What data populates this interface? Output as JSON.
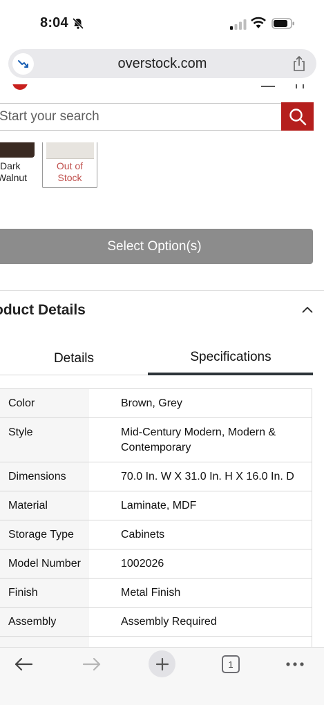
{
  "status_bar": {
    "time": "8:04"
  },
  "browser": {
    "url": "overstock.com"
  },
  "search": {
    "placeholder": "Start your search"
  },
  "color_options": [
    {
      "label": "Dark\nWalnut",
      "display": "Dark Walnut",
      "state": "available"
    },
    {
      "label": "Out of\nStock",
      "display": "Out of Stock",
      "state": "out_of_stock"
    }
  ],
  "swatch_labels": {
    "dark_line1": "Dark",
    "dark_line2": "Walnut",
    "oos_line1": "Out of",
    "oos_line2": "Stock"
  },
  "select_button": {
    "label": "Select Option(s)"
  },
  "product_details": {
    "title": "oduct Details",
    "tabs": [
      {
        "label": "Details",
        "active": false
      },
      {
        "label": "Specifications",
        "active": true
      }
    ]
  },
  "specifications": [
    {
      "key": "Color",
      "value": "Brown, Grey"
    },
    {
      "key": "Style",
      "value": "Mid-Century Modern, Modern & Contemporary"
    },
    {
      "key": "Dimensions",
      "value": "70.0 In. W X 31.0 In. H X 16.0 In. D"
    },
    {
      "key": "Material",
      "value": "Laminate, MDF"
    },
    {
      "key": "Storage Type",
      "value": "Cabinets"
    },
    {
      "key": "Model Number",
      "value": "1002026"
    },
    {
      "key": "Finish",
      "value": "Metal Finish"
    },
    {
      "key": "Assembly",
      "value": "Assembly Required"
    }
  ],
  "bottom_toolbar": {
    "tab_count": "1"
  },
  "colors": {
    "brand_red": "#b51f1d",
    "button_gray": "#8c8c8c",
    "out_of_stock": "#c0504d",
    "tab_active": "#2d3439"
  },
  "icons": [
    "bell-slash-icon",
    "cellular-signal-icon",
    "wifi-icon",
    "battery-icon",
    "tracking-protection-icon",
    "share-icon",
    "search-icon",
    "chevron-up-icon",
    "back-arrow-icon",
    "forward-arrow-icon",
    "plus-icon",
    "tabs-icon",
    "more-icon"
  ]
}
